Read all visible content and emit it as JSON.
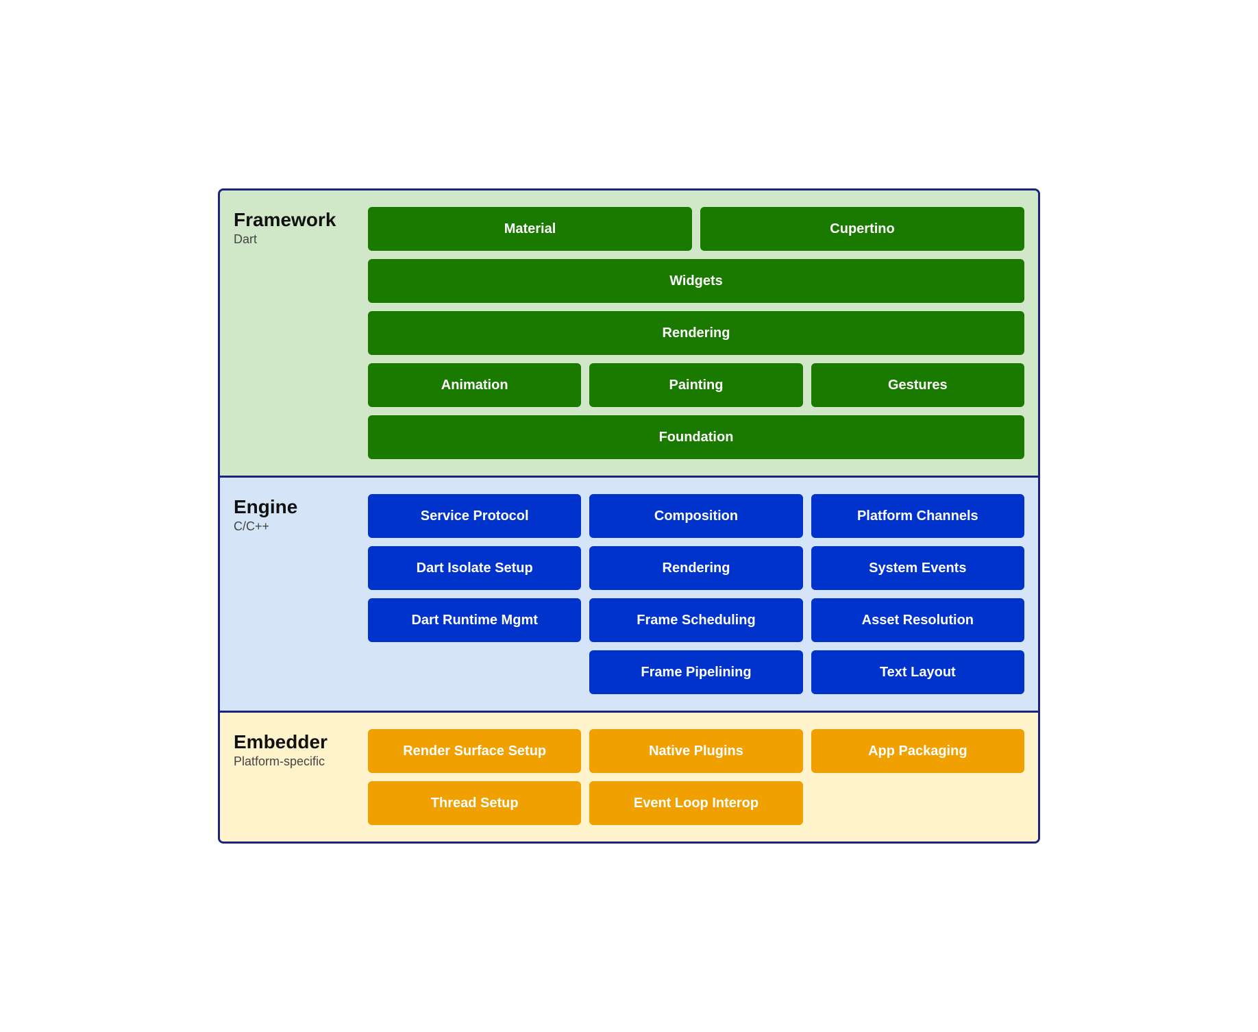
{
  "framework": {
    "title": "Framework",
    "subtitle": "Dart",
    "rows": [
      [
        "Material",
        "Cupertino"
      ],
      [
        "Widgets"
      ],
      [
        "Rendering"
      ],
      [
        "Animation",
        "Painting",
        "Gestures"
      ],
      [
        "Foundation"
      ]
    ]
  },
  "engine": {
    "title": "Engine",
    "subtitle": "C/C++",
    "rows": [
      [
        "Service Protocol",
        "Composition",
        "Platform Channels"
      ],
      [
        "Dart Isolate Setup",
        "Rendering",
        "System Events"
      ],
      [
        "Dart Runtime Mgmt",
        "Frame Scheduling",
        "Asset Resolution"
      ],
      [
        "",
        "Frame Pipelining",
        "Text Layout"
      ]
    ]
  },
  "embedder": {
    "title": "Embedder",
    "subtitle": "Platform-specific",
    "rows": [
      [
        "Render Surface Setup",
        "Native Plugins",
        "App Packaging"
      ],
      [
        "Thread Setup",
        "Event Loop Interop",
        ""
      ]
    ]
  }
}
